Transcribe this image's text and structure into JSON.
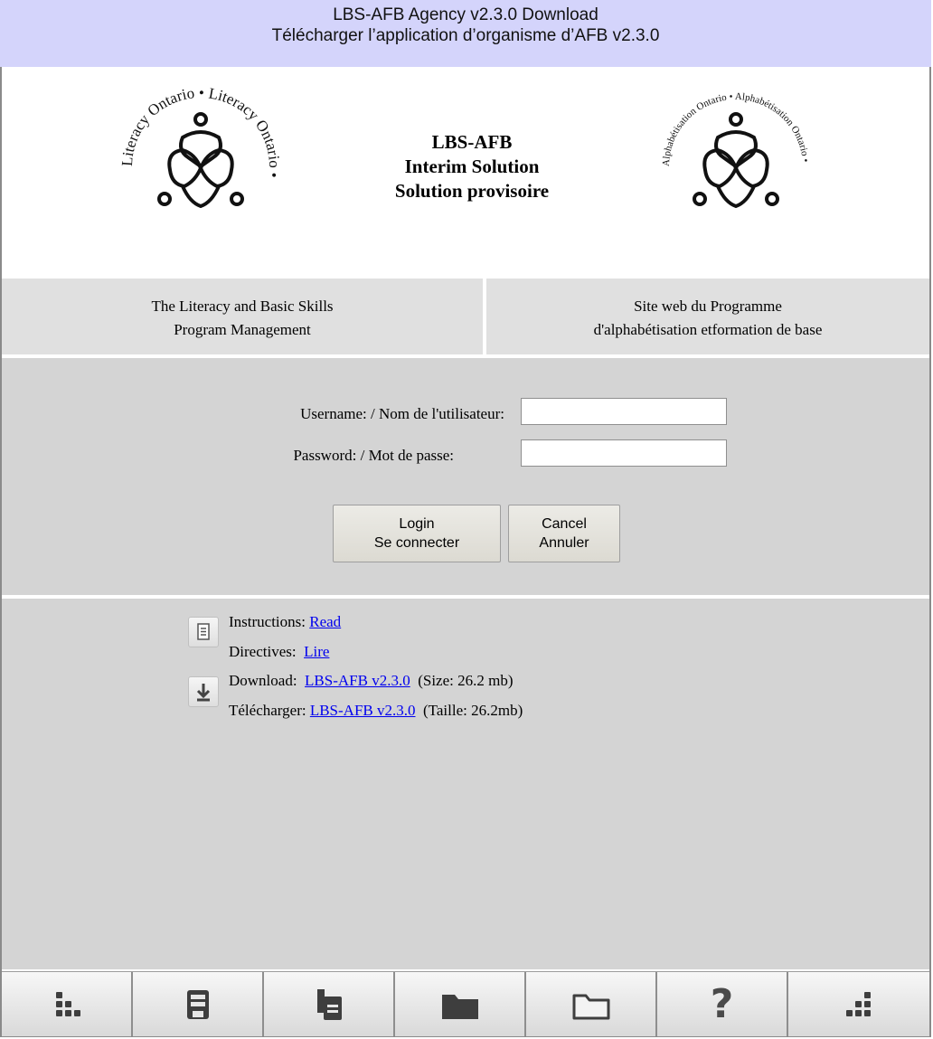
{
  "header": {
    "title_en": "LBS-AFB Agency v2.3.0 Download",
    "title_fr": "Télécharger l’application d’organisme d’AFB v2.3.0"
  },
  "banner": {
    "logo_left_ring_text": "Literacy Ontario • Literacy Ontario •",
    "logo_right_ring_text": "Alphabétisation Ontario • Alphabétisation Ontario •",
    "line1": "LBS-AFB",
    "line2": "Interim Solution",
    "line3": "Solution provisoire"
  },
  "program": {
    "left_line1": "The Literacy and Basic Skills",
    "left_line2": "Program Management",
    "right_line1": "Site web du Programme",
    "right_line2": "d'alphabétisation etformation de base"
  },
  "login": {
    "username_label": "Username: / Nom de l'utilisateur:",
    "username_value": "",
    "password_label": "Password: / Mot de passe:",
    "password_value": "",
    "login_line1": "Login",
    "login_line2": "Se connecter",
    "cancel_line1": "Cancel",
    "cancel_line2": "Annuler"
  },
  "info": {
    "instructions_label": "Instructions:",
    "instructions_link": "Read",
    "directives_label": "Directives:",
    "directives_link": "Lire",
    "download_label": "Download:",
    "download_link": "LBS-AFB v2.3.0",
    "download_size": "(Size: 26.2 mb)",
    "telecharger_label": "Télécharger:",
    "telecharger_link": "LBS-AFB v2.3.0",
    "telecharger_size": "(Taille: 26.2mb)",
    "icons": [
      "document-icon",
      "download-icon"
    ]
  },
  "toolbar": {
    "icons": [
      "apps-grid-icon",
      "save-icon",
      "copy-icon",
      "folder-filled-icon",
      "folder-outline-icon",
      "help-icon",
      "more-grid-icon"
    ]
  },
  "colors": {
    "title_bg": "#d4d4fb",
    "panel_bg": "#d4d4d4",
    "program_bg": "#e0e0e0",
    "link": "#0000ee"
  }
}
